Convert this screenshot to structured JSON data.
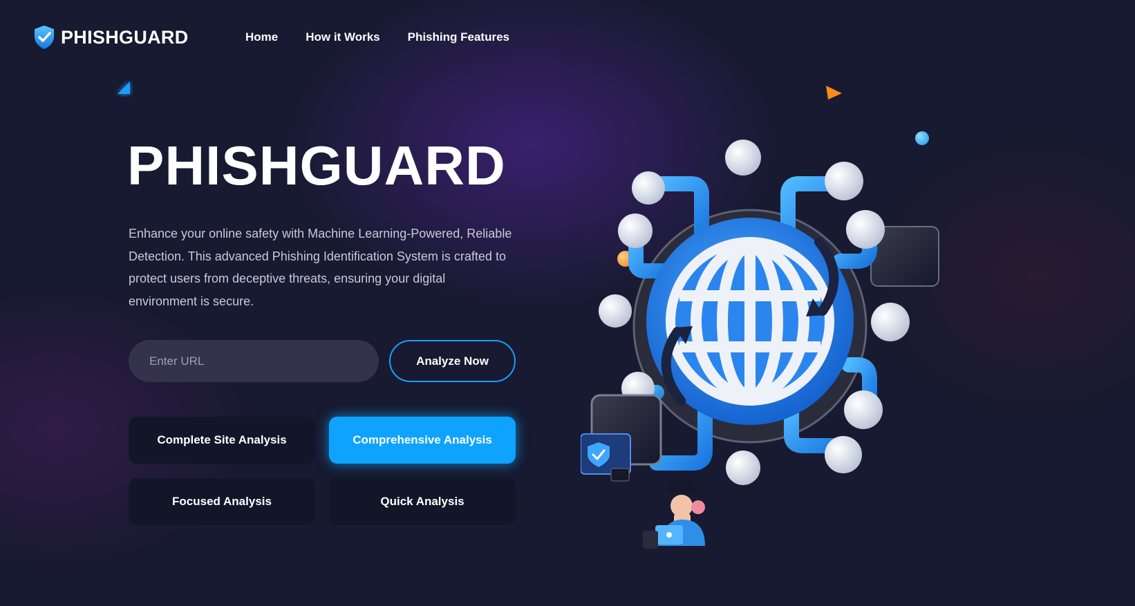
{
  "brand": {
    "name": "PHISHGUARD",
    "logo_icon": "shield-check-icon"
  },
  "nav": {
    "items": [
      "Home",
      "How it Works",
      "Phishing Features"
    ]
  },
  "hero": {
    "title": "PHISHGUARD",
    "description": "Enhance your online safety with Machine Learning-Powered, Reliable Detection. This advanced Phishing Identification System is crafted to protect users from deceptive threats, ensuring your digital environment is secure."
  },
  "search": {
    "placeholder": "Enter URL",
    "value": "",
    "button_label": "Analyze Now"
  },
  "modes": {
    "items": [
      "Complete Site Analysis",
      "Comprehensive Analysis",
      "Focused Analysis",
      "Quick Analysis"
    ],
    "active": "Comprehensive Analysis"
  },
  "colors": {
    "accent": "#0ea3ff",
    "background": "#171a30",
    "input_bg": "#34324d",
    "card_bg": "#111729",
    "globe_blue": "#2a8ff0"
  },
  "illustration": {
    "icons": [
      "globe-network-icon",
      "hacker-icon",
      "shield-window-icon",
      "triangle-icon",
      "orb-icon"
    ]
  }
}
